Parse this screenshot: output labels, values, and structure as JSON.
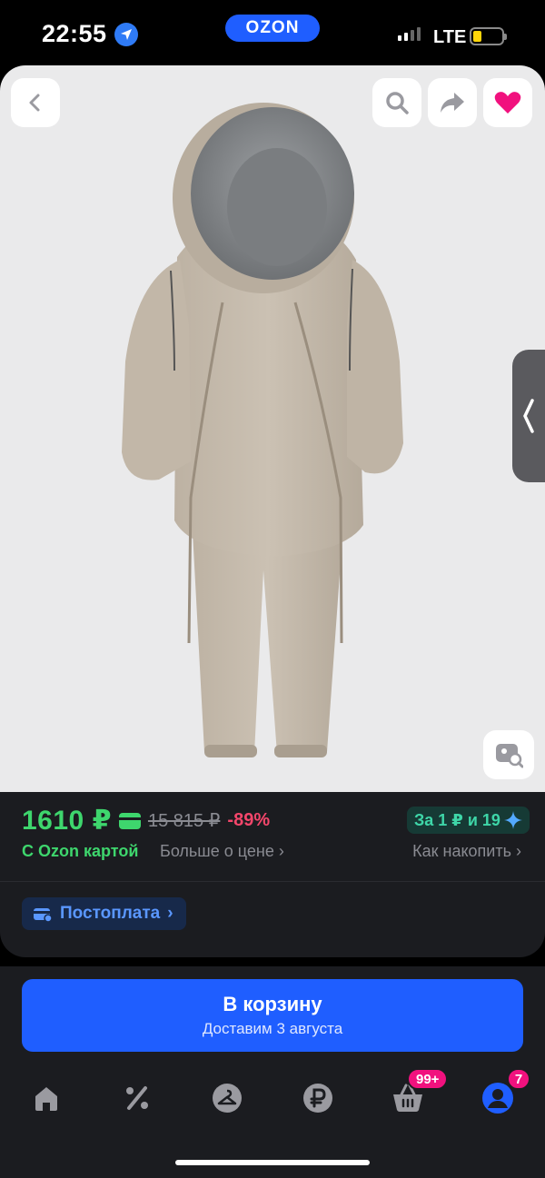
{
  "status_bar": {
    "time": "22:55",
    "network": "LTE",
    "brand": "OZON"
  },
  "product": {
    "price": "1610 ₽",
    "old_price": "15 815 ₽",
    "discount": "-89%",
    "points_badge": "За 1 ₽ и 19",
    "ozon_card_label": "С Ozon картой",
    "more_about_price": "Больше о цене",
    "how_to_collect": "Как накопить",
    "postpay_label": "Постоплата"
  },
  "cart_button": {
    "title": "В корзину",
    "subtitle": "Доставим 3 августа"
  },
  "tabbar": {
    "cart_badge": "99+",
    "profile_badge": "7"
  },
  "colors": {
    "accent_blue": "#1f5eff",
    "price_green": "#3ed66d",
    "discount_red": "#f4466b",
    "favorite_pink": "#f1117e",
    "panel_bg": "#1b1c20"
  },
  "icons": [
    "location-icon",
    "back-icon",
    "search-icon",
    "share-icon",
    "heart-icon",
    "image-search-icon",
    "home-icon",
    "percent-icon",
    "hanger-icon",
    "ruble-icon",
    "basket-icon",
    "profile-icon"
  ]
}
